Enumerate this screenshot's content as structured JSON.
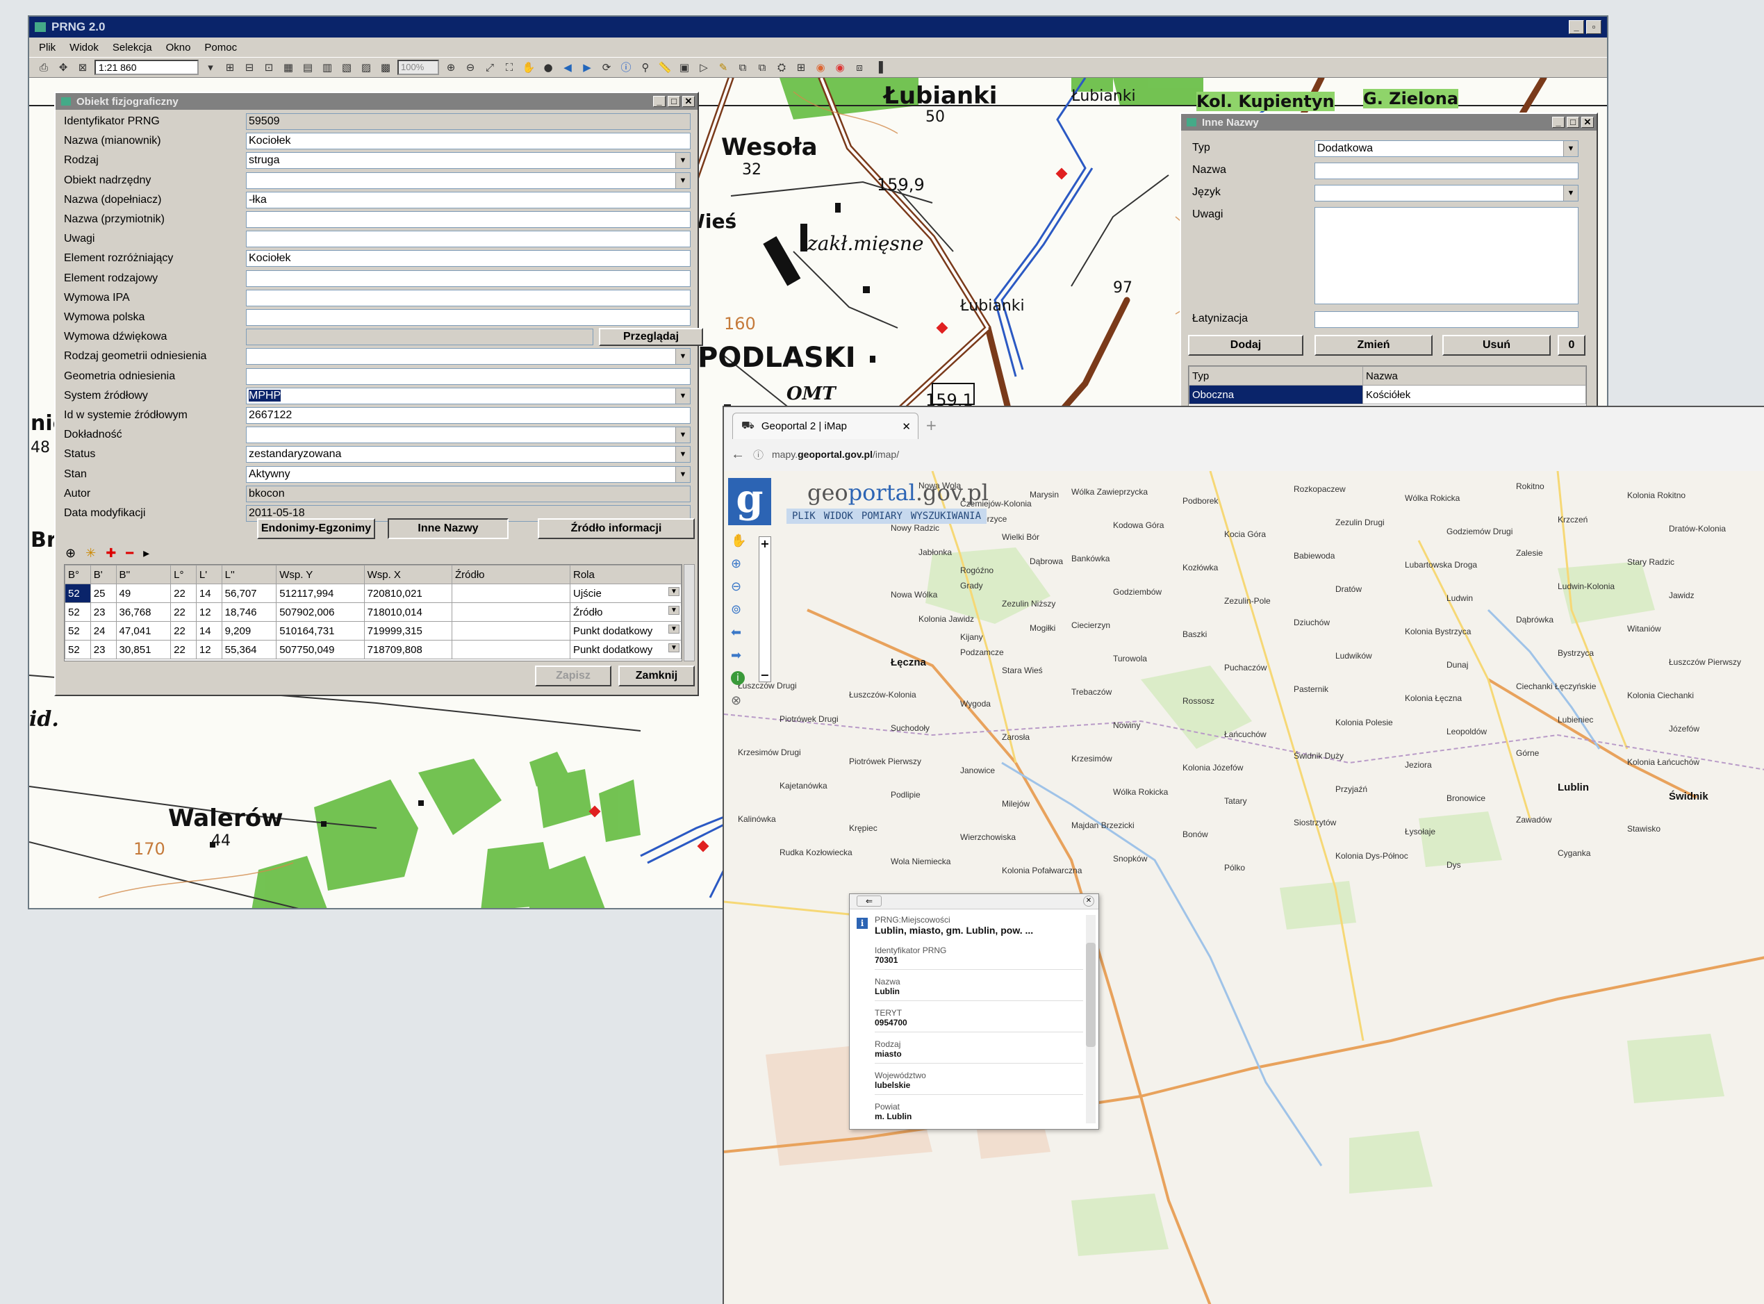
{
  "prng": {
    "title": "PRNG 2.0",
    "menu": [
      "Plik",
      "Widok",
      "Selekcja",
      "Okno",
      "Pomoc"
    ],
    "scale": "1:21 860",
    "zoom": "100%",
    "map_labels": [
      {
        "text": "Łubianki",
        "cls": "big"
      },
      {
        "text": "50",
        "cls": "num"
      },
      {
        "text": "Łubianki",
        "cls": "sm"
      },
      {
        "text": "Wesoła",
        "cls": "big"
      },
      {
        "text": "32",
        "cls": "num"
      },
      {
        "text": "159,9",
        "cls": "num"
      },
      {
        "text": "Wieś",
        "cls": "big"
      },
      {
        "text": "zakł.mięsne",
        "cls": "ital"
      },
      {
        "text": "Łubianki",
        "cls": "sm"
      },
      {
        "text": "PODLASKI",
        "cls": "huge"
      },
      {
        "text": "OMT",
        "cls": "ital"
      },
      {
        "text": "159,1",
        "cls": "num"
      },
      {
        "text": "Walerów",
        "cls": "big"
      },
      {
        "text": "44",
        "cls": "num"
      },
      {
        "text": "170",
        "cls": "brown"
      },
      {
        "text": "Kol. Kupientyn",
        "cls": "big"
      },
      {
        "text": "G. Zielona",
        "cls": "big"
      },
      {
        "text": "97",
        "cls": "num"
      },
      {
        "text": "160",
        "cls": "brown"
      },
      {
        "text": "id.",
        "cls": "big"
      },
      {
        "text": "Br",
        "cls": "big"
      },
      {
        "text": "nic",
        "cls": "big"
      },
      {
        "text": "48",
        "cls": "num"
      }
    ],
    "obiekt": {
      "title": "Obiekt fizjograficzny",
      "fields": [
        {
          "label": "Identyfikator PRNG",
          "value": "59509",
          "type": "dis"
        },
        {
          "label": "Nazwa (mianownik)",
          "value": "Kociołek",
          "type": "text"
        },
        {
          "label": "Rodzaj",
          "value": "struga",
          "type": "dd"
        },
        {
          "label": "Obiekt nadrzędny",
          "value": "",
          "type": "dl"
        },
        {
          "label": "Nazwa (dopełniacz)",
          "value": "-łka",
          "type": "text"
        },
        {
          "label": "Nazwa (przymiotnik)",
          "value": "",
          "type": "text"
        },
        {
          "label": "Uwagi",
          "value": "",
          "type": "text"
        },
        {
          "label": "Element rozróżniający",
          "value": "Kociołek",
          "type": "text"
        },
        {
          "label": "Element rodzajowy",
          "value": "",
          "type": "text"
        },
        {
          "label": "Wymowa IPA",
          "value": "",
          "type": "text"
        },
        {
          "label": "Wymowa polska",
          "value": "",
          "type": "text"
        },
        {
          "label": "Wymowa dźwiękowa",
          "value": "",
          "type": "dis"
        },
        {
          "label": "Rodzaj geometrii odniesienia",
          "value": "",
          "type": "dd"
        },
        {
          "label": "Geometria odniesienia",
          "value": "",
          "type": "text"
        },
        {
          "label": "System źródłowy",
          "value": "MPHP",
          "type": "ddsel"
        },
        {
          "label": "Id w systemie źródłowym",
          "value": "2667122",
          "type": "text"
        },
        {
          "label": "Dokładność",
          "value": "",
          "type": "dd"
        },
        {
          "label": "Status",
          "value": "zestandaryzowana",
          "type": "dd"
        },
        {
          "label": "Stan",
          "value": "Aktywny",
          "type": "dd"
        },
        {
          "label": "Autor",
          "value": "bkocon",
          "type": "dis"
        },
        {
          "label": "Data modyfikacji",
          "value": "2011-05-18",
          "type": "dis"
        }
      ],
      "przegladaj": "Przeglądaj",
      "tab_buttons": [
        "Endonimy-Egzonimy",
        "Inne Nazwy",
        "Źródło informacji"
      ],
      "coord_headers": [
        "B°",
        "B'",
        "B''",
        "L°",
        "L'",
        "L''",
        "Wsp. Y",
        "Wsp. X",
        "Źródło",
        "Rola"
      ],
      "coord_rows": [
        [
          "52",
          "25",
          "49",
          "22",
          "14",
          "56,707",
          "512117,994",
          "720810,021",
          "",
          "Ujście"
        ],
        [
          "52",
          "23",
          "36,768",
          "22",
          "12",
          "18,746",
          "507902,006",
          "718010,014",
          "",
          "Źródło"
        ],
        [
          "52",
          "24",
          "47,041",
          "22",
          "14",
          "9,209",
          "510164,731",
          "719999,315",
          "",
          "Punkt dodatkowy"
        ],
        [
          "52",
          "23",
          "30,851",
          "22",
          "12",
          "55,364",
          "507750,049",
          "718709,808",
          "",
          "Punkt dodatkowy"
        ]
      ],
      "zapisz": "Zapisz",
      "zamknij": "Zamknij"
    },
    "inne": {
      "title": "Inne Nazwy",
      "typ_label": "Typ",
      "typ_value": "Dodatkowa",
      "nazwa_label": "Nazwa",
      "jezyk_label": "Język",
      "uwagi_label": "Uwagi",
      "lat_label": "Łatynizacja",
      "buttons": [
        "Dodaj",
        "Zmień",
        "Usuń"
      ],
      "count": "0",
      "list_headers": [
        "Typ",
        "Nazwa"
      ],
      "list_rows": [
        [
          "Oboczna",
          "Kościółek"
        ]
      ]
    }
  },
  "browser": {
    "tab_title": "Geoportal 2 | iMap",
    "url_prefix": "mapy.",
    "url_domain": "geoportal.gov.pl",
    "url_path": "/imap/",
    "logo_text": "geoportal.gov.pl",
    "logo_prefix": "geo",
    "logo_rest": "portal",
    "logo_suffix": ".gov.pl",
    "menu": [
      "PLIK",
      "WIDOK",
      "POMIARY",
      "WYSZUKIWANIA"
    ],
    "popup": {
      "category": "PRNG:Miejscowości",
      "heading": "Lublin, miasto, gm. Lublin, pow. ...",
      "rows": [
        {
          "label": "Identyfikator PRNG",
          "value": "70301"
        },
        {
          "label": "Nazwa",
          "value": "Lublin"
        },
        {
          "label": "TERYT",
          "value": "0954700"
        },
        {
          "label": "Rodzaj",
          "value": "miasto"
        },
        {
          "label": "Województwo",
          "value": "lubelskie"
        },
        {
          "label": "Powiat",
          "value": "m. Lublin"
        }
      ]
    },
    "map_labels": [
      "Nowa Wola",
      "Marysin",
      "Czemiejów-Kolonia",
      "Wólka Zawieprzycka",
      "Podborek",
      "Rozkopaczew",
      "Wólka Rokicka",
      "Rokitno",
      "Kolonia Rokitno",
      "Zawieprzyce",
      "Nowy Radzic",
      "Wielki Bór",
      "Kodowa Góra",
      "Kocia Góra",
      "Zezulin Drugi",
      "Godziemów Drugi",
      "Krzczeń",
      "Dratów-Kolonia",
      "Jabłonka",
      "Dąbrowa",
      "Rogóźno",
      "Bankówka",
      "Kozłówka",
      "Babiewoda",
      "Lubartowska Droga",
      "Zalesie",
      "Stary Radzic",
      "Grady",
      "Nowa Wólka",
      "Zezulin Niższy",
      "Godziembów",
      "Zezulin-Pole",
      "Dratów",
      "Ludwin",
      "Ludwin-Kolonia",
      "Jawidz",
      "Kolonia Jawidz",
      "Mogiłki",
      "Kijany",
      "Ciecierzyn",
      "Baszki",
      "Dziuchów",
      "Kolonia Bystrzyca",
      "Dąbrówka",
      "Witaniów",
      "Podzamcze",
      "Łęczna",
      "Stara Wieś",
      "Turowola",
      "Puchaczów",
      "Ludwików",
      "Dunaj",
      "Bystrzyca",
      "Łuszczów Pierwszy",
      "Łuszczów Drugi",
      "Łuszczów-Kolonia",
      "Wygoda",
      "Trebaczów",
      "Rossosz",
      "Pasternik",
      "Kolonia Łęczna",
      "Ciechanki Łęczyńskie",
      "Kolonia Ciechanki",
      "Piotrówek Drugi",
      "Suchodoły",
      "Zarosła",
      "Nowiny",
      "Łańcuchów",
      "Kolonia Polesie",
      "Leopoldów",
      "Lubieniec",
      "Józefów",
      "Krzesimów Drugi",
      "Piotrówek Pierwszy",
      "Janowice",
      "Krzesimów",
      "Kolonia Józefów",
      "Świdnik Duży",
      "Jeziora",
      "Górne",
      "Kolonia Łańcuchów",
      "Kajetanówka",
      "Podlipie",
      "Milejów",
      "Wólka Rokicka",
      "Tatary",
      "Przyjaźń",
      "Bronowice",
      "Lublin",
      "Świdnik",
      "Kalinówka",
      "Krępiec",
      "Wierzchowiska",
      "Majdan Brzezicki",
      "Bonów",
      "Siostrzytów",
      "Łysołaje",
      "Zawadów",
      "Stawisko",
      "Rudka Kozłowiecka",
      "Wola Niemiecka",
      "Kolonia Pofałwarczna",
      "Snopków",
      "Pólko",
      "Kolonia Dys-Północ",
      "Dys",
      "Cyganka"
    ]
  }
}
